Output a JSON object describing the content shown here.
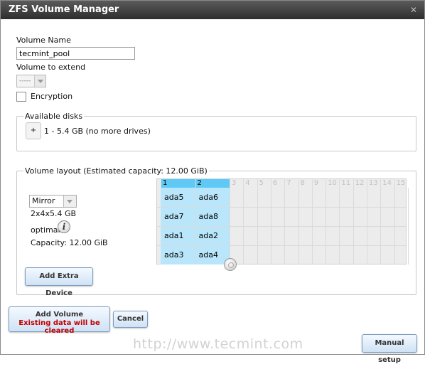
{
  "window": {
    "title": "ZFS Volume Manager",
    "close_symbol": "✕"
  },
  "form": {
    "volume_name_label": "Volume Name",
    "volume_name_value": "tecmint_pool",
    "volume_extend_label": "Volume to extend",
    "volume_extend_value": "-----",
    "encryption_label": "Encryption"
  },
  "available_disks": {
    "legend": "Available disks",
    "add_symbol": "+",
    "disk_text": "1 - 5.4 GB (no more drives)"
  },
  "volume_layout": {
    "legend": "Volume layout (Estimated capacity: 12.00 GiB)",
    "layout_type": "Mirror",
    "disk_config": "2x4x5.4 GB",
    "status": "optimal",
    "info_symbol": "i",
    "capacity": "Capacity: 12.00 GiB",
    "column_headers": [
      "1",
      "2",
      "3",
      "4",
      "5",
      "6",
      "7",
      "8",
      "9",
      "10",
      "11",
      "12",
      "13",
      "14",
      "15"
    ],
    "selected_columns": 2,
    "rows": [
      [
        "ada5",
        "ada6"
      ],
      [
        "ada7",
        "ada8"
      ],
      [
        "ada1",
        "ada2"
      ],
      [
        "ada3",
        "ada4"
      ]
    ]
  },
  "buttons": {
    "add_extra_device": "Add Extra Device",
    "add_volume": "Add Volume",
    "add_volume_warning": "Existing data will be cleared",
    "cancel": "Cancel",
    "manual_setup": "Manual setup"
  },
  "watermark": "http://www.tecmint.com"
}
